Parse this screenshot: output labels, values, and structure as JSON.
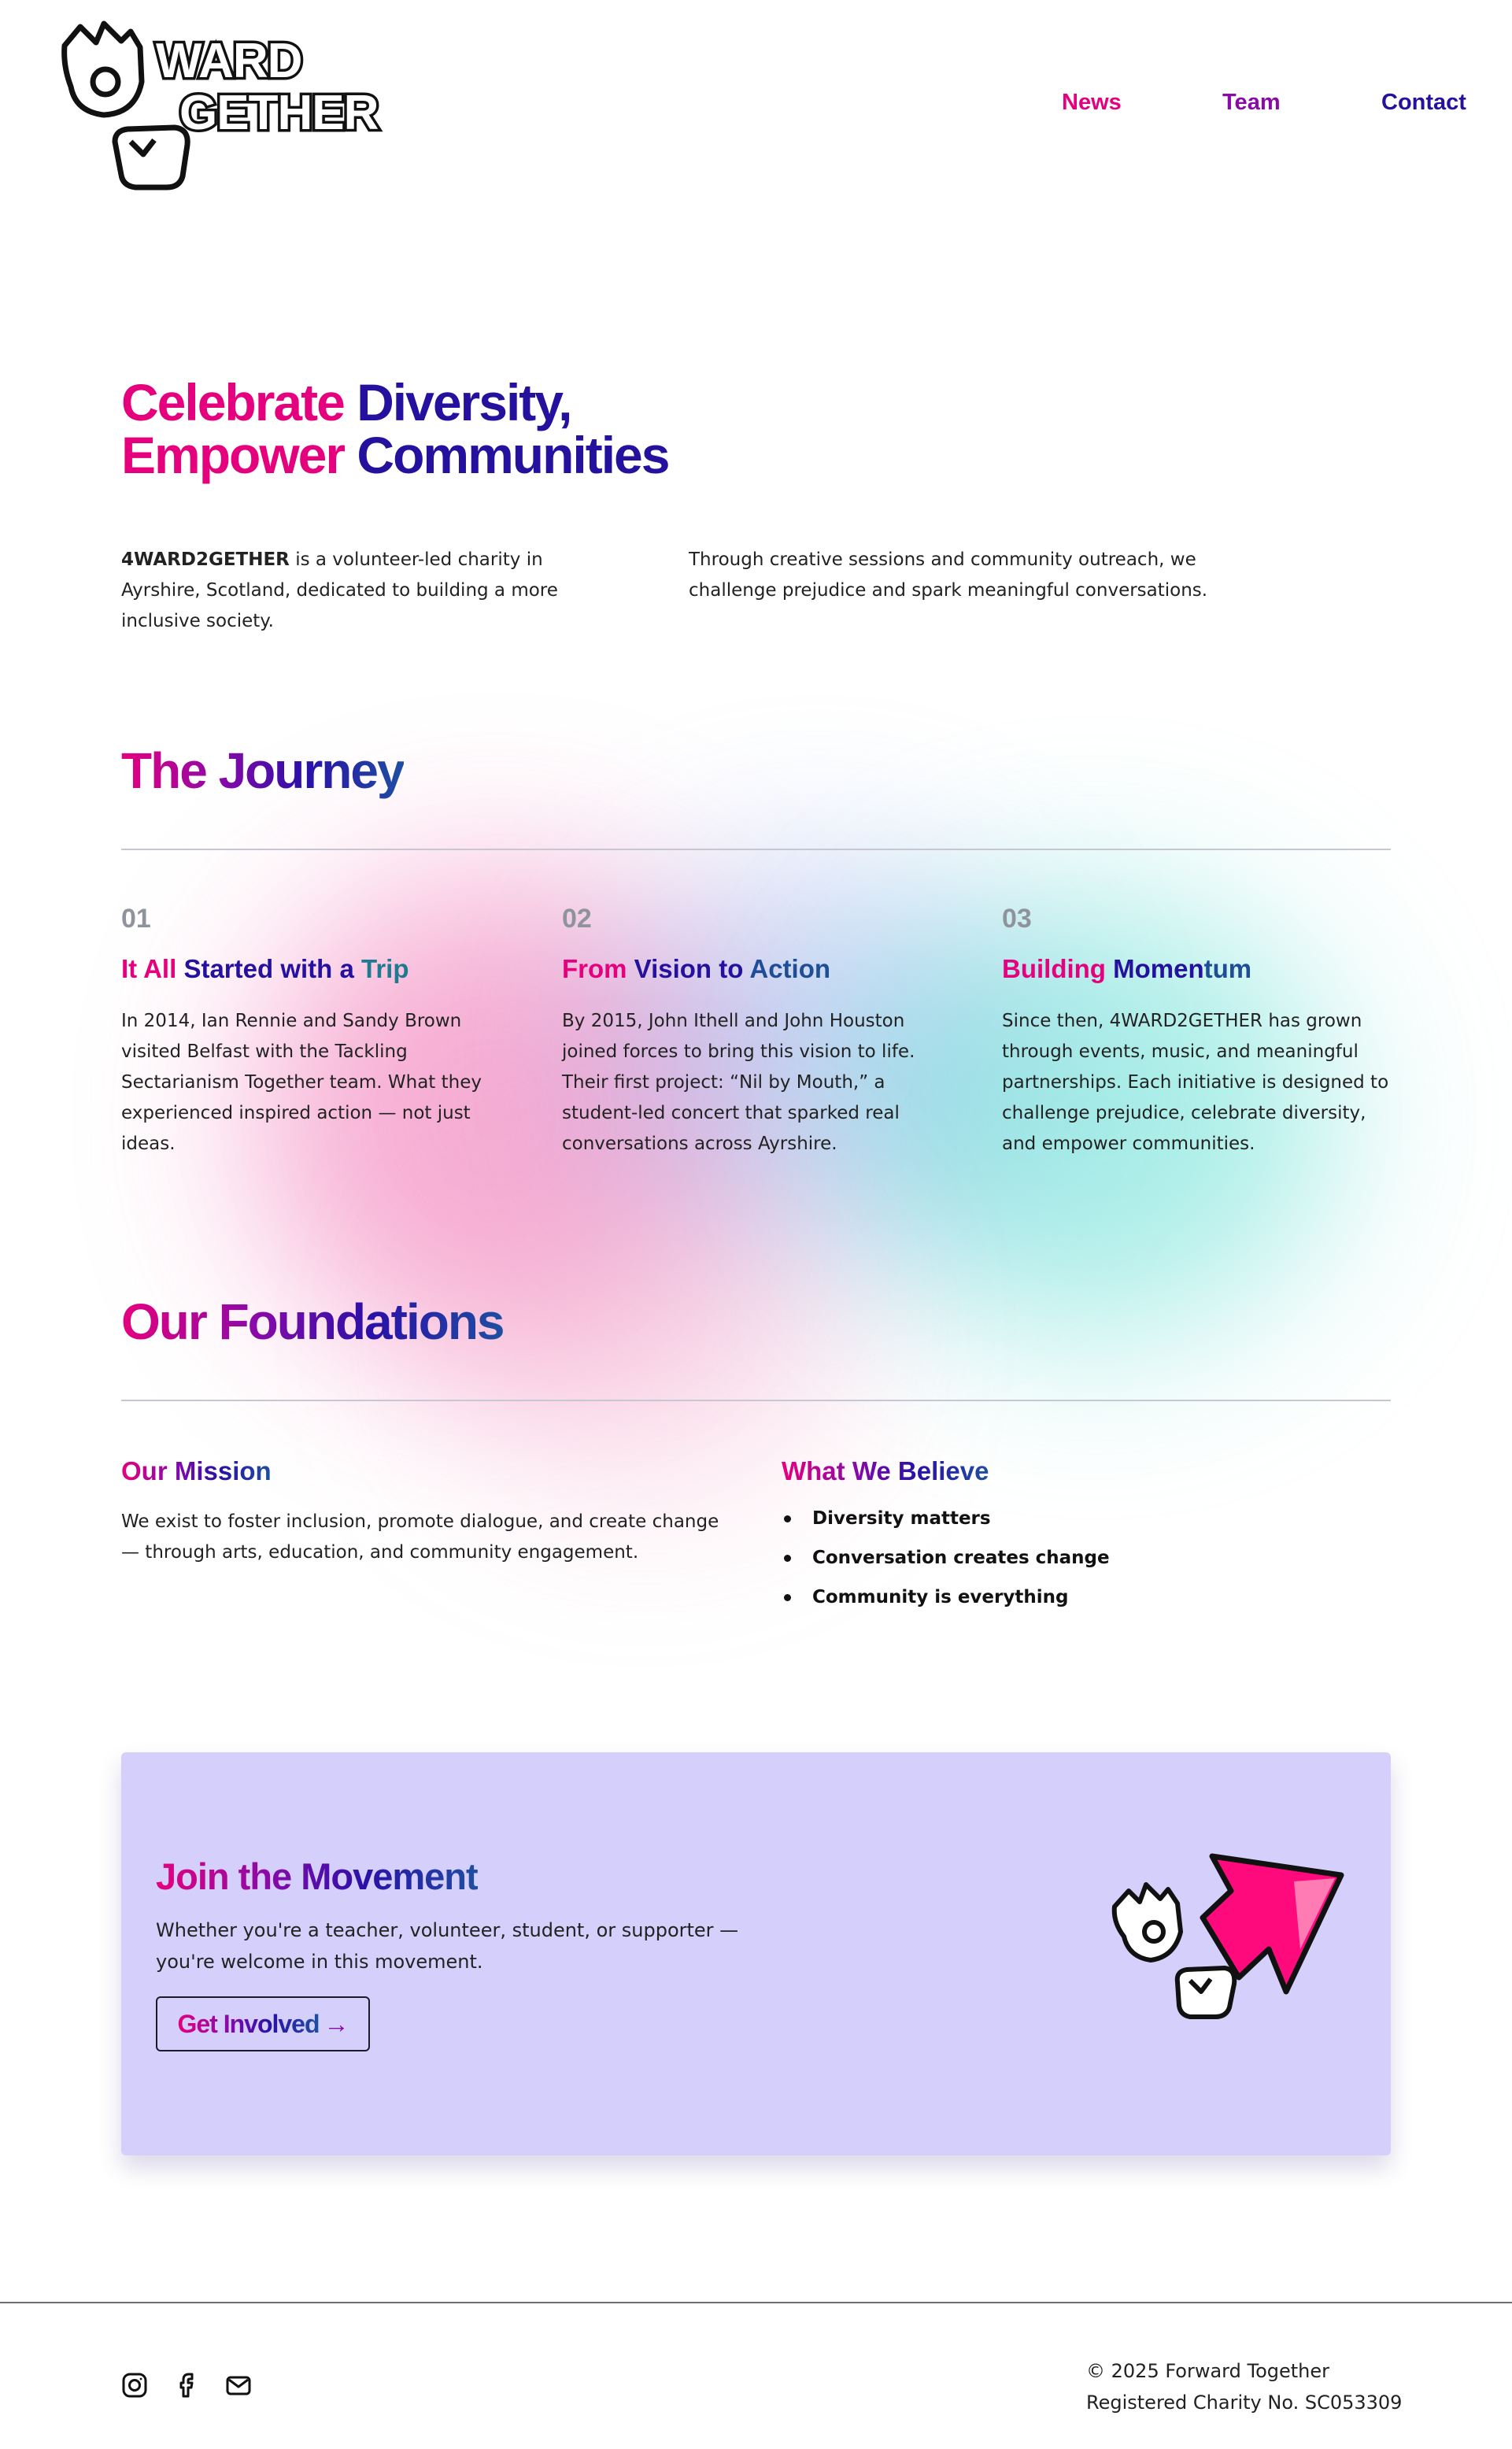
{
  "logo": {
    "text_top": "WARD",
    "text_bottom": "GETHER",
    "alt": "4WARD2GETHER"
  },
  "nav": {
    "news": "News",
    "team": "Team",
    "contact": "Contact"
  },
  "hero": {
    "title_line1_a": "Celebrate ",
    "title_line1_b": "Diversity,",
    "title_line2_a": "Empower ",
    "title_line2_b": "Communities",
    "p1_strong": "4WARD2GETHER",
    "p1_rest": " is a volunteer-led charity in Ayrshire, Scotland, dedicated to building a more inclusive society.",
    "p2": "Through creative sessions and community outreach, we challenge prejudice and spark meaningful conversations."
  },
  "journey": {
    "title": "The Journey",
    "steps": [
      {
        "num": "01",
        "title_a": "It All ",
        "title_b": "Started with a ",
        "title_c": "Trip",
        "body": "In 2014, Ian Rennie and Sandy Brown visited Belfast with the Tackling Sectarianism Together team. What they experienced inspired action — not just ideas."
      },
      {
        "num": "02",
        "title_a": "From ",
        "title_b": "Vision to ",
        "title_c": "Action",
        "body": "By 2015, John Ithell and John Houston joined forces to bring this vision to life. Their first project: “Nil by Mouth,” a student-led concert that sparked real conversations across Ayrshire."
      },
      {
        "num": "03",
        "title_a": "Building ",
        "title_b": "Momen",
        "title_c": "tum",
        "body": "Since then, 4WARD2GETHER has grown through events, music, and meaningful partnerships. Each initiative is designed to challenge prejudice, celebrate diversity, and empower communities."
      }
    ]
  },
  "foundations": {
    "title": "Our Foundations",
    "mission_title": "Our Mission",
    "mission_body": "We exist to foster inclusion, promote dialogue, and create change — through arts, education, and community engagement.",
    "believe_title": "What We Believe",
    "beliefs": [
      "Diversity matters",
      "Conversation creates change",
      "Community is everything"
    ]
  },
  "cta": {
    "title": "Join the Movement",
    "body": "Whether you're a teacher, volunteer, student, or supporter — you're welcome in this movement.",
    "button_label": "Get Involved",
    "button_arrow": "→"
  },
  "footer": {
    "icons": [
      "instagram-icon",
      "facebook-icon",
      "mail-icon"
    ],
    "copyright": "© 2025 Forward Together",
    "charity": "Registered Charity No. SC053309"
  },
  "colors": {
    "pink": "#e5007e",
    "purple": "#8a0aa8",
    "indigo": "#24119e",
    "blue": "#1f4d96",
    "cta_bg": "#d5cffc"
  }
}
